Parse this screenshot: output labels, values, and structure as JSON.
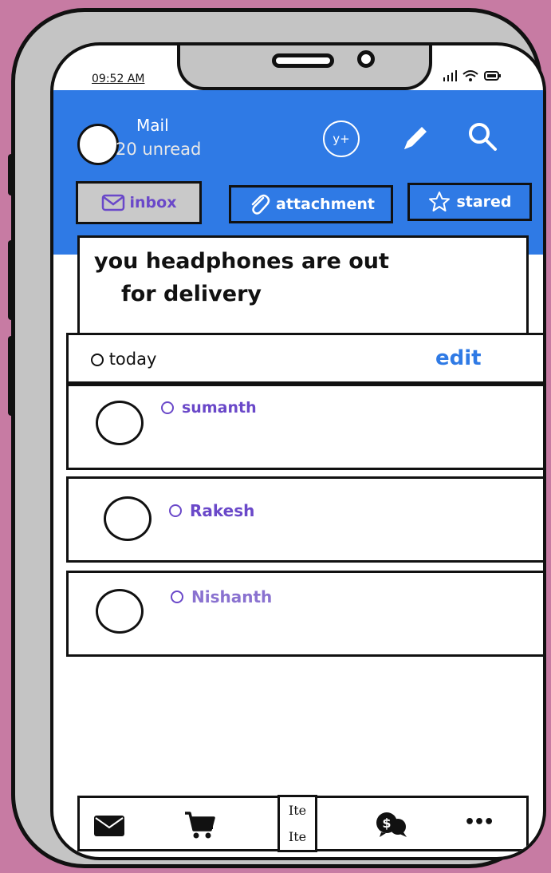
{
  "status_bar": {
    "time": "09:52 AM"
  },
  "header": {
    "title": "Mail",
    "unread": "20 unread",
    "invite_label": "y+"
  },
  "tabs": [
    {
      "label": "inbox",
      "icon": "envelope-icon"
    },
    {
      "label": "attachment",
      "icon": "paperclip-icon"
    },
    {
      "label": "stared",
      "icon": "star-icon"
    }
  ],
  "notification": {
    "line1": "you headphones are out",
    "line2": "for delivery"
  },
  "section": {
    "title": "today",
    "action": "edit"
  },
  "contacts": [
    {
      "name": "sumanth"
    },
    {
      "name": "Rakesh"
    },
    {
      "name": "Nishanth"
    }
  ],
  "bottom_nav": {
    "center_line1": "Ite",
    "center_line2": "Ite",
    "more": "•••"
  },
  "colors": {
    "accent": "#2f7ae5",
    "purple": "#6a48c9",
    "background": "#c77ba3"
  }
}
